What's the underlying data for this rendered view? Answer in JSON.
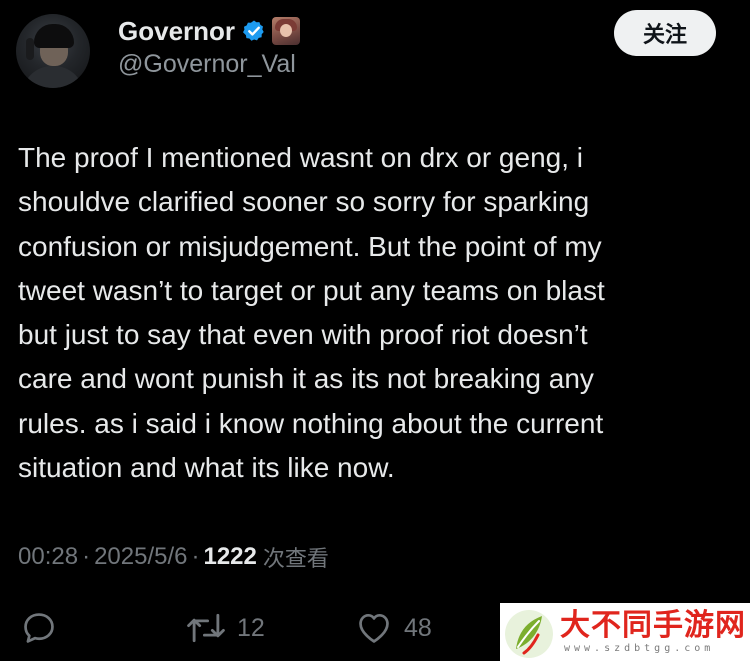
{
  "user": {
    "display_name": "Governor",
    "handle": "@Governor_Val",
    "verified_icon": "verified-badge-icon",
    "badge_icon": "anime-avatar-badge"
  },
  "follow_button": {
    "label": "关注"
  },
  "tweet": {
    "text": "The proof I mentioned wasnt on drx or geng, i\nshouldve clarified sooner so sorry for sparking\nconfusion or misjudgement. But the point of my\ntweet wasn’t to target or put any teams on blast\nbut just to say that even with proof riot doesn’t\ncare and wont punish it as its not breaking any\nrules. as i said i know nothing about the current\nsituation and what its like now."
  },
  "meta": {
    "time": "00:28",
    "separator": "·",
    "date": "2025/5/6",
    "view_count": "1222",
    "views_label": "次查看"
  },
  "actions": {
    "reply": {
      "icon": "reply-icon",
      "count": ""
    },
    "retweet": {
      "icon": "retweet-icon",
      "count": "12"
    },
    "like": {
      "icon": "heart-icon",
      "count": "48"
    }
  },
  "watermark": {
    "title": "大不同手游网",
    "subtitle": "www.szdbtgg.com"
  },
  "colors": {
    "background": "#000000",
    "text": "#e7e9ea",
    "secondary_text": "#71767b",
    "verified_blue": "#1d9bf0",
    "watermark_red": "#e0251d",
    "watermark_green": "#7cae2e"
  }
}
